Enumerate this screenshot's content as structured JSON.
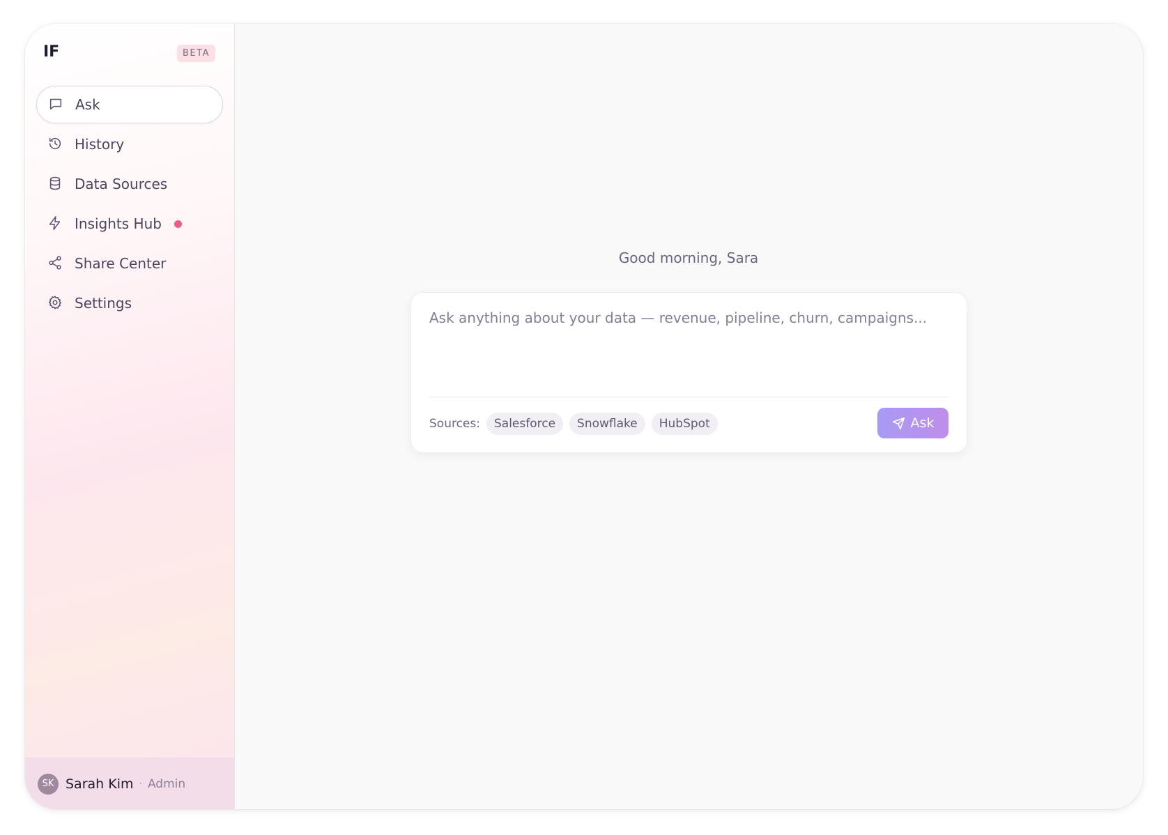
{
  "sidebar": {
    "brand": "IF",
    "badge": "BETA",
    "items": [
      {
        "label": "Ask",
        "icon": "chat-bubble-icon",
        "active": true
      },
      {
        "label": "History",
        "icon": "history-icon"
      },
      {
        "label": "Data Sources",
        "icon": "database-icon"
      },
      {
        "label": "Insights Hub",
        "icon": "lightning-icon",
        "notification": true
      },
      {
        "label": "Share Center",
        "icon": "share-icon"
      },
      {
        "label": "Settings",
        "icon": "gear-icon"
      }
    ],
    "notification_color": "#ee5a8a"
  },
  "user": {
    "initials": "SK",
    "name": "Sarah Kim",
    "separator": "·",
    "role": "Admin"
  },
  "main": {
    "greeting": "Good morning, Sara",
    "prompt_placeholder": "Ask anything about your data — revenue, pipeline, churn, campaigns...",
    "sources_label": "Sources:",
    "sources": [
      "Salesforce",
      "Snowflake",
      "HubSpot"
    ],
    "ask_label": "Ask"
  },
  "colors": {
    "accent_gradient_start": "#a79bf5",
    "accent_gradient_end": "#bf8de9"
  }
}
